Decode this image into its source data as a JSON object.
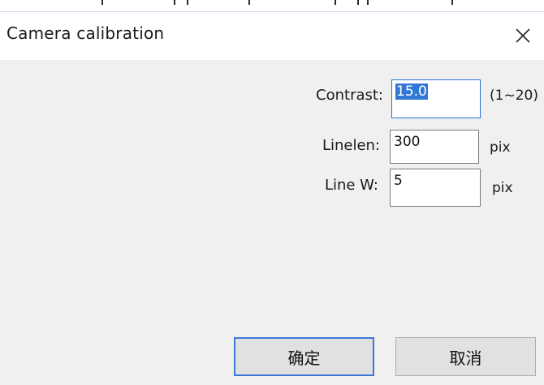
{
  "window": {
    "title": "Camera calibration",
    "close_icon": "close-icon"
  },
  "form": {
    "contrast": {
      "label": "Contrast:",
      "value": "15.0",
      "range": "(1~20)"
    },
    "linelen": {
      "label": "Linelen:",
      "value": "300",
      "unit": "pix"
    },
    "linew": {
      "label": "Line W:",
      "value": "5",
      "unit": "pix"
    }
  },
  "buttons": {
    "ok_label": "确定",
    "cancel_label": "取消"
  },
  "colors": {
    "accent": "#3b78d8",
    "selection": "#3377d6"
  }
}
